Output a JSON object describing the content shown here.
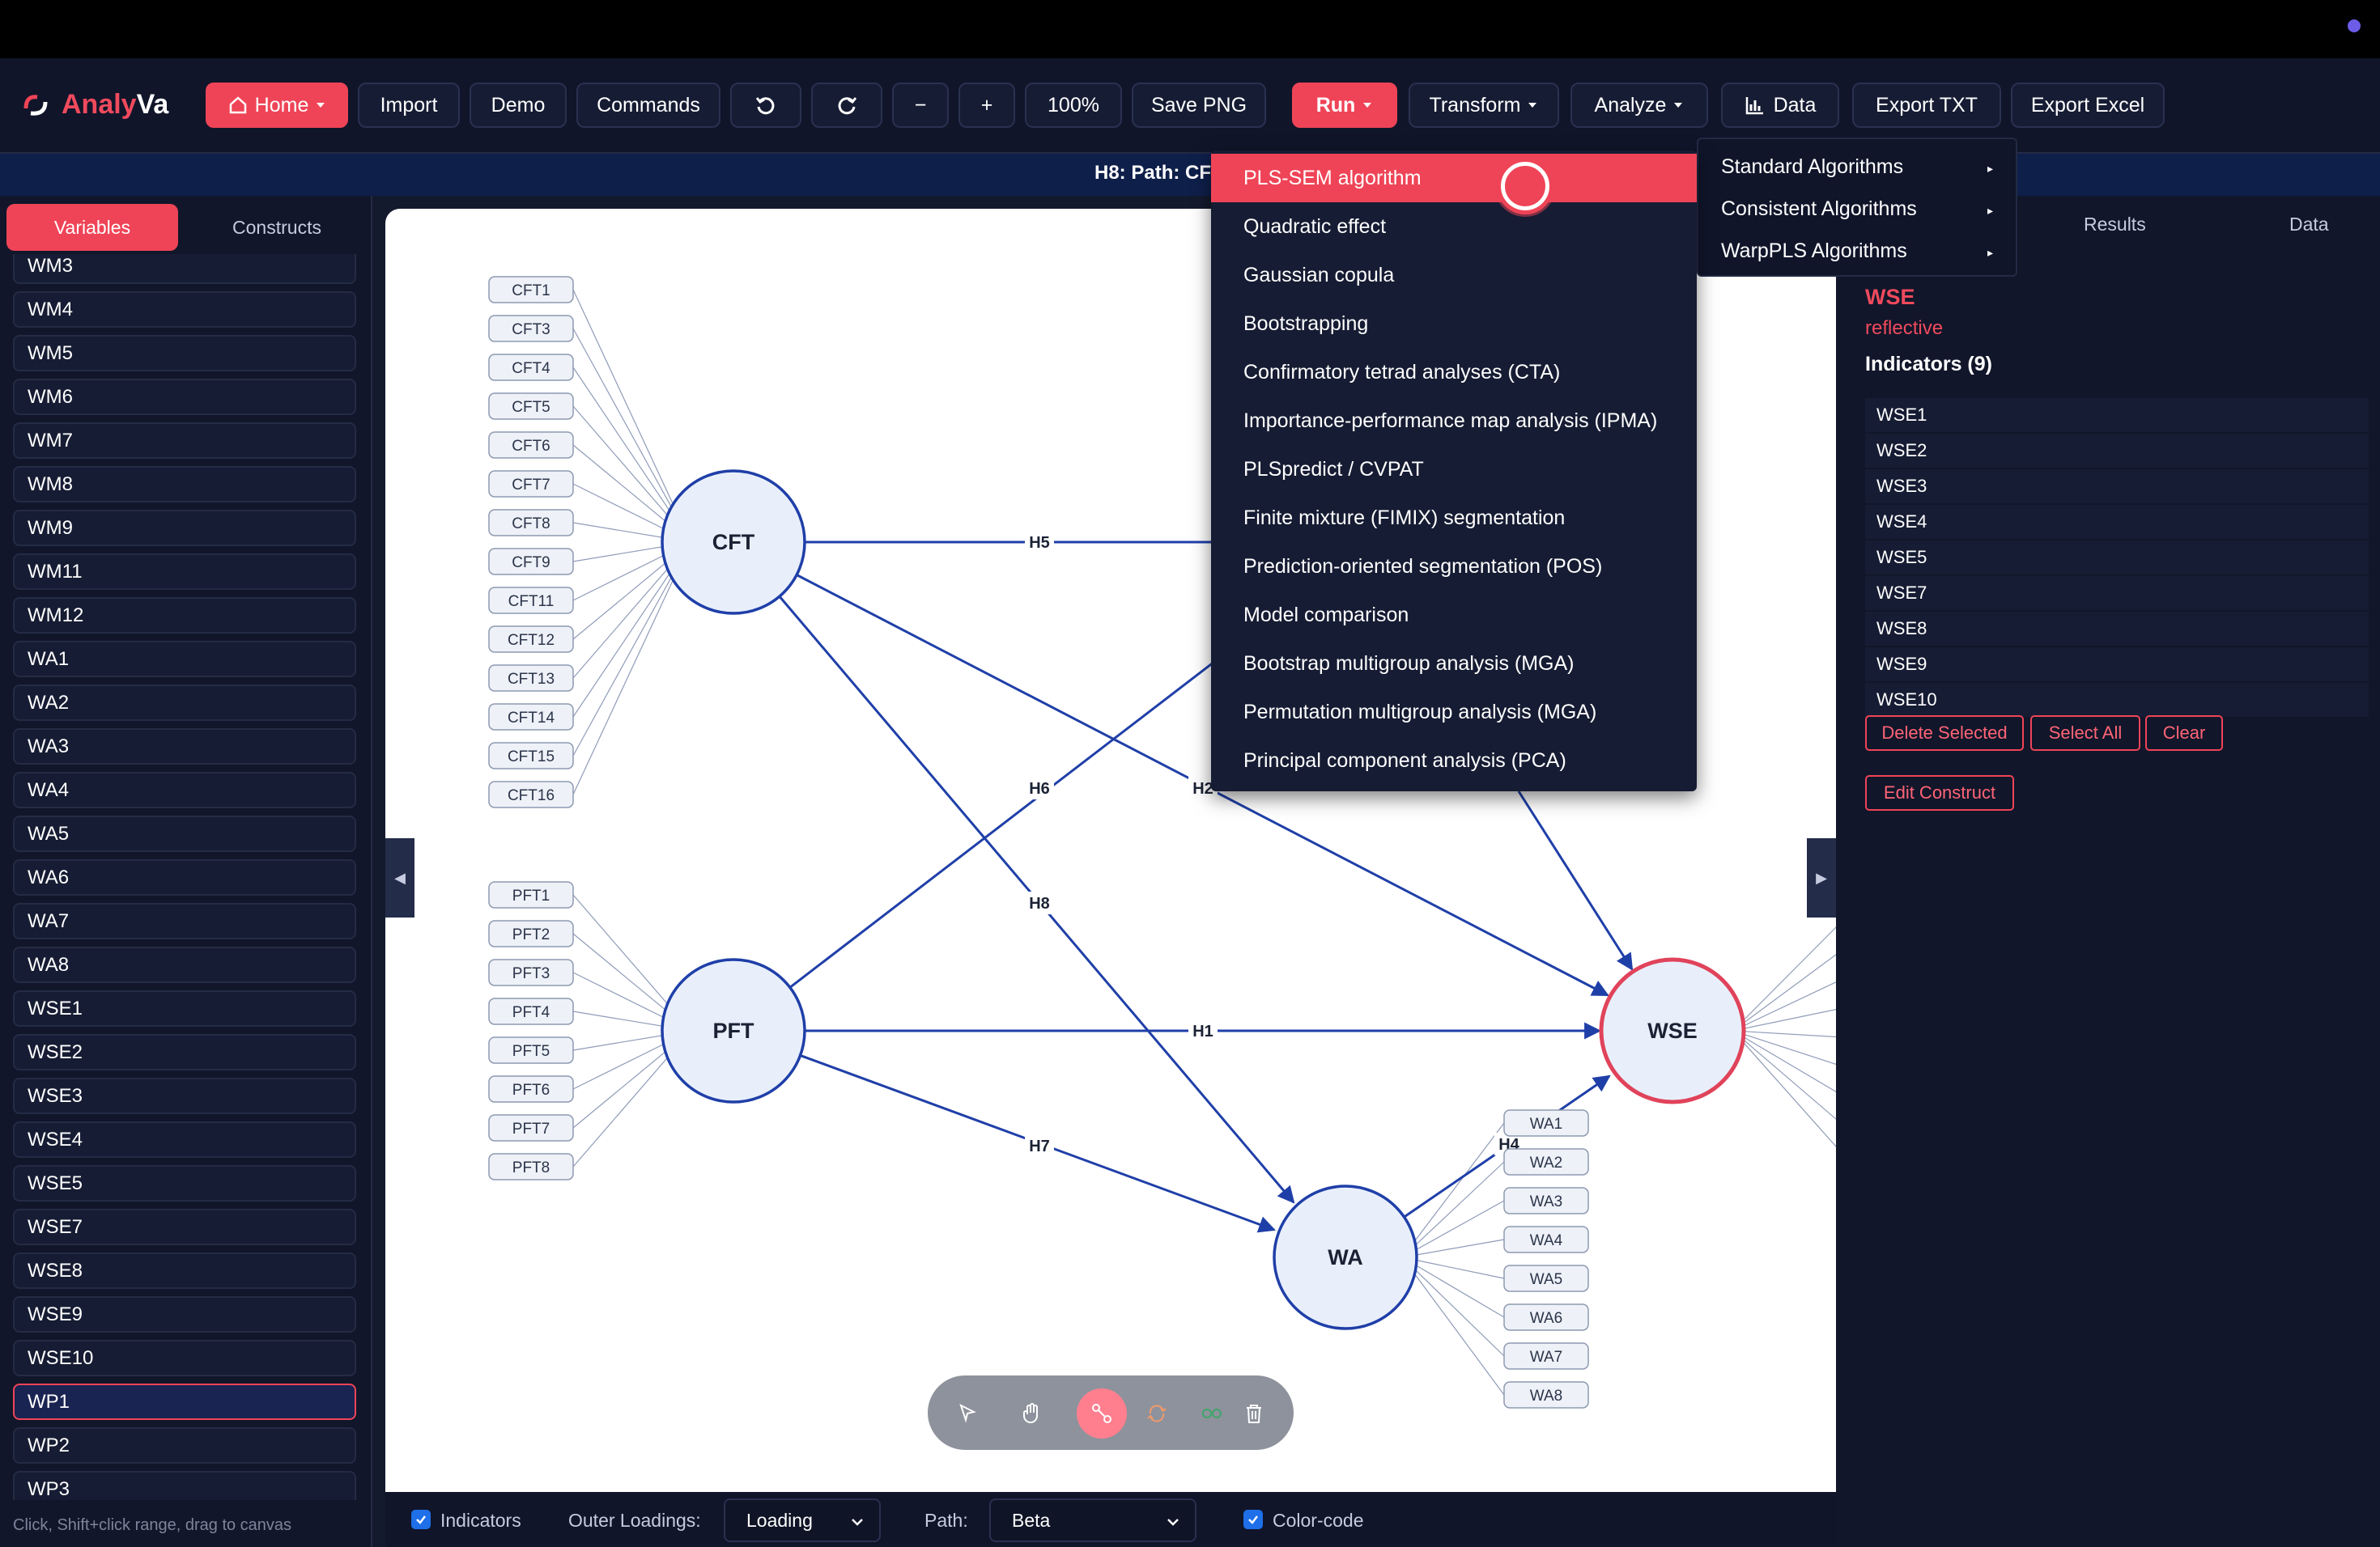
{
  "app": {
    "name_part1": "Analy",
    "name_part2": "Va"
  },
  "toolbar": {
    "home": "Home",
    "import": "Import",
    "demo": "Demo",
    "commands": "Commands",
    "zoom_out": "−",
    "zoom_in": "+",
    "zoom": "100%",
    "save_png": "Save PNG",
    "run": "Run",
    "transform": "Transform",
    "analyze": "Analyze",
    "data": "Data",
    "export_txt": "Export TXT",
    "export_excel": "Export Excel"
  },
  "path_bar": "H8: Path: CF",
  "left_panel": {
    "tabs": [
      "Variables",
      "Constructs"
    ],
    "variables": [
      "WM3",
      "WM4",
      "WM5",
      "WM6",
      "WM7",
      "WM8",
      "WM9",
      "WM11",
      "WM12",
      "WA1",
      "WA2",
      "WA3",
      "WA4",
      "WA5",
      "WA6",
      "WA7",
      "WA8",
      "WSE1",
      "WSE2",
      "WSE3",
      "WSE4",
      "WSE5",
      "WSE7",
      "WSE8",
      "WSE9",
      "WSE10",
      "WP1",
      "WP2",
      "WP3"
    ],
    "selected": "WP1",
    "hint": "Click, Shift+click range, drag to canvas"
  },
  "diagram": {
    "constructs": [
      "CFT",
      "PFT",
      "WA",
      "WSE"
    ],
    "cft_indicators": [
      "CFT1",
      "CFT3",
      "CFT4",
      "CFT5",
      "CFT6",
      "CFT7",
      "CFT8",
      "CFT9",
      "CFT11",
      "CFT12",
      "CFT13",
      "CFT14",
      "CFT15",
      "CFT16"
    ],
    "pft_indicators": [
      "PFT1",
      "PFT2",
      "PFT3",
      "PFT4",
      "PFT5",
      "PFT6",
      "PFT7",
      "PFT8"
    ],
    "wa_indicators": [
      "WA1",
      "WA2",
      "WA3",
      "WA4",
      "WA5",
      "WA6",
      "WA7",
      "WA8"
    ],
    "paths": [
      "H1",
      "H2",
      "H4",
      "H5",
      "H6",
      "H7",
      "H8"
    ]
  },
  "bottom_bar": {
    "indicators": "Indicators",
    "outer_loadings_label": "Outer Loadings:",
    "outer_loadings": "Loading",
    "path_label": "Path:",
    "path_value": "Beta",
    "color_code": "Color-code"
  },
  "right_panel": {
    "tabs": [
      "Results",
      "Data"
    ],
    "construct_name": "WSE",
    "construct_type": "reflective",
    "indicators_heading": "Indicators (9)",
    "indicators": [
      "WSE1",
      "WSE2",
      "WSE3",
      "WSE4",
      "WSE5",
      "WSE7",
      "WSE8",
      "WSE9",
      "WSE10"
    ],
    "delete_selected": "Delete Selected",
    "select_all": "Select All",
    "clear": "Clear",
    "edit_construct": "Edit Construct"
  },
  "run_menu": {
    "items": [
      "PLS-SEM algorithm",
      "Quadratic effect",
      "Gaussian copula",
      "Bootstrapping",
      "Confirmatory tetrad analyses (CTA)",
      "Importance-performance map analysis (IPMA)",
      "PLSpredict / CVPAT",
      "Finite mixture (FIMIX) segmentation",
      "Prediction-oriented segmentation (POS)",
      "Model comparison",
      "Bootstrap multigroup analysis (MGA)",
      "Permutation multigroup analysis (MGA)",
      "Principal component analysis (PCA)"
    ],
    "highlighted": "PLS-SEM algorithm"
  },
  "submenu": {
    "items": [
      "Standard Algorithms",
      "Consistent Algorithms",
      "WarpPLS Algorithms"
    ]
  },
  "colors": {
    "accent": "#ef4457",
    "node_stroke": "#1f3fa8",
    "node_fill": "#e8effb",
    "selected_node": "#e0435a"
  }
}
